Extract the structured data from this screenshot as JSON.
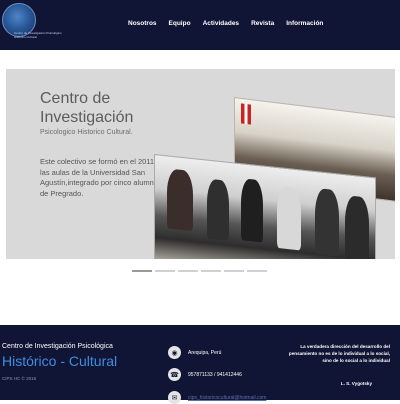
{
  "header": {
    "logo_text": "Centro de Investigación Psicológico Histórico Cultural",
    "nav": [
      "Nosotros",
      "Equipo",
      "Actividades",
      "Revista",
      "Información"
    ]
  },
  "slide": {
    "title_line1": "Centro de",
    "title_line2": "Investigación",
    "subtitle": "Psicologico Historico Cultural.",
    "body": "Este colectivo se formó en el 2011, en las aulas de la Universidad San Agustín,integrado por cinco alumnos de Pregrado."
  },
  "slider_dots": {
    "count": 6,
    "active_index": 0
  },
  "footer": {
    "title_line1": "Centro de Investigación Psicológica",
    "title_line2": "Histórico - Cultural",
    "copyright": "CIPS HC © 2016",
    "location": "Arequipa, Perú",
    "phone": "957871133 / 941412446",
    "email": "cips_historicocultural@hotmail.com",
    "quote": "La verdadera dirección del desarrollo del pensamiento no es de lo individual a lo social, sino de lo social a lo individual",
    "quote_author": "L. S. Vygotsky"
  },
  "colors": {
    "header_bg": "#111535",
    "footer_bg": "#111535",
    "accent": "#3f8ee0",
    "slider_bg": "#d9d9d9"
  }
}
